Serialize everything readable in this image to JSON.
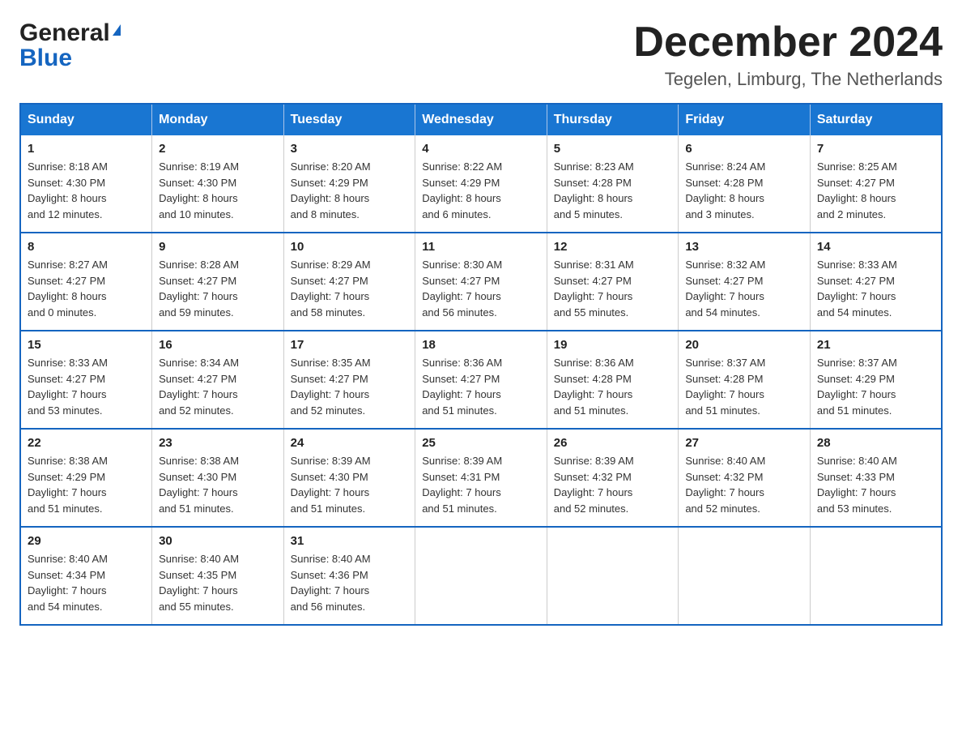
{
  "header": {
    "logo_general": "General",
    "logo_blue": "Blue",
    "month_title": "December 2024",
    "location": "Tegelen, Limburg, The Netherlands"
  },
  "weekdays": [
    "Sunday",
    "Monday",
    "Tuesday",
    "Wednesday",
    "Thursday",
    "Friday",
    "Saturday"
  ],
  "weeks": [
    [
      {
        "day": "1",
        "sunrise": "8:18 AM",
        "sunset": "4:30 PM",
        "daylight": "8 hours and 12 minutes."
      },
      {
        "day": "2",
        "sunrise": "8:19 AM",
        "sunset": "4:30 PM",
        "daylight": "8 hours and 10 minutes."
      },
      {
        "day": "3",
        "sunrise": "8:20 AM",
        "sunset": "4:29 PM",
        "daylight": "8 hours and 8 minutes."
      },
      {
        "day": "4",
        "sunrise": "8:22 AM",
        "sunset": "4:29 PM",
        "daylight": "8 hours and 6 minutes."
      },
      {
        "day": "5",
        "sunrise": "8:23 AM",
        "sunset": "4:28 PM",
        "daylight": "8 hours and 5 minutes."
      },
      {
        "day": "6",
        "sunrise": "8:24 AM",
        "sunset": "4:28 PM",
        "daylight": "8 hours and 3 minutes."
      },
      {
        "day": "7",
        "sunrise": "8:25 AM",
        "sunset": "4:27 PM",
        "daylight": "8 hours and 2 minutes."
      }
    ],
    [
      {
        "day": "8",
        "sunrise": "8:27 AM",
        "sunset": "4:27 PM",
        "daylight": "8 hours and 0 minutes."
      },
      {
        "day": "9",
        "sunrise": "8:28 AM",
        "sunset": "4:27 PM",
        "daylight": "7 hours and 59 minutes."
      },
      {
        "day": "10",
        "sunrise": "8:29 AM",
        "sunset": "4:27 PM",
        "daylight": "7 hours and 58 minutes."
      },
      {
        "day": "11",
        "sunrise": "8:30 AM",
        "sunset": "4:27 PM",
        "daylight": "7 hours and 56 minutes."
      },
      {
        "day": "12",
        "sunrise": "8:31 AM",
        "sunset": "4:27 PM",
        "daylight": "7 hours and 55 minutes."
      },
      {
        "day": "13",
        "sunrise": "8:32 AM",
        "sunset": "4:27 PM",
        "daylight": "7 hours and 54 minutes."
      },
      {
        "day": "14",
        "sunrise": "8:33 AM",
        "sunset": "4:27 PM",
        "daylight": "7 hours and 54 minutes."
      }
    ],
    [
      {
        "day": "15",
        "sunrise": "8:33 AM",
        "sunset": "4:27 PM",
        "daylight": "7 hours and 53 minutes."
      },
      {
        "day": "16",
        "sunrise": "8:34 AM",
        "sunset": "4:27 PM",
        "daylight": "7 hours and 52 minutes."
      },
      {
        "day": "17",
        "sunrise": "8:35 AM",
        "sunset": "4:27 PM",
        "daylight": "7 hours and 52 minutes."
      },
      {
        "day": "18",
        "sunrise": "8:36 AM",
        "sunset": "4:27 PM",
        "daylight": "7 hours and 51 minutes."
      },
      {
        "day": "19",
        "sunrise": "8:36 AM",
        "sunset": "4:28 PM",
        "daylight": "7 hours and 51 minutes."
      },
      {
        "day": "20",
        "sunrise": "8:37 AM",
        "sunset": "4:28 PM",
        "daylight": "7 hours and 51 minutes."
      },
      {
        "day": "21",
        "sunrise": "8:37 AM",
        "sunset": "4:29 PM",
        "daylight": "7 hours and 51 minutes."
      }
    ],
    [
      {
        "day": "22",
        "sunrise": "8:38 AM",
        "sunset": "4:29 PM",
        "daylight": "7 hours and 51 minutes."
      },
      {
        "day": "23",
        "sunrise": "8:38 AM",
        "sunset": "4:30 PM",
        "daylight": "7 hours and 51 minutes."
      },
      {
        "day": "24",
        "sunrise": "8:39 AM",
        "sunset": "4:30 PM",
        "daylight": "7 hours and 51 minutes."
      },
      {
        "day": "25",
        "sunrise": "8:39 AM",
        "sunset": "4:31 PM",
        "daylight": "7 hours and 51 minutes."
      },
      {
        "day": "26",
        "sunrise": "8:39 AM",
        "sunset": "4:32 PM",
        "daylight": "7 hours and 52 minutes."
      },
      {
        "day": "27",
        "sunrise": "8:40 AM",
        "sunset": "4:32 PM",
        "daylight": "7 hours and 52 minutes."
      },
      {
        "day": "28",
        "sunrise": "8:40 AM",
        "sunset": "4:33 PM",
        "daylight": "7 hours and 53 minutes."
      }
    ],
    [
      {
        "day": "29",
        "sunrise": "8:40 AM",
        "sunset": "4:34 PM",
        "daylight": "7 hours and 54 minutes."
      },
      {
        "day": "30",
        "sunrise": "8:40 AM",
        "sunset": "4:35 PM",
        "daylight": "7 hours and 55 minutes."
      },
      {
        "day": "31",
        "sunrise": "8:40 AM",
        "sunset": "4:36 PM",
        "daylight": "7 hours and 56 minutes."
      },
      null,
      null,
      null,
      null
    ]
  ],
  "labels": {
    "sunrise": "Sunrise:",
    "sunset": "Sunset:",
    "daylight": "Daylight:"
  }
}
